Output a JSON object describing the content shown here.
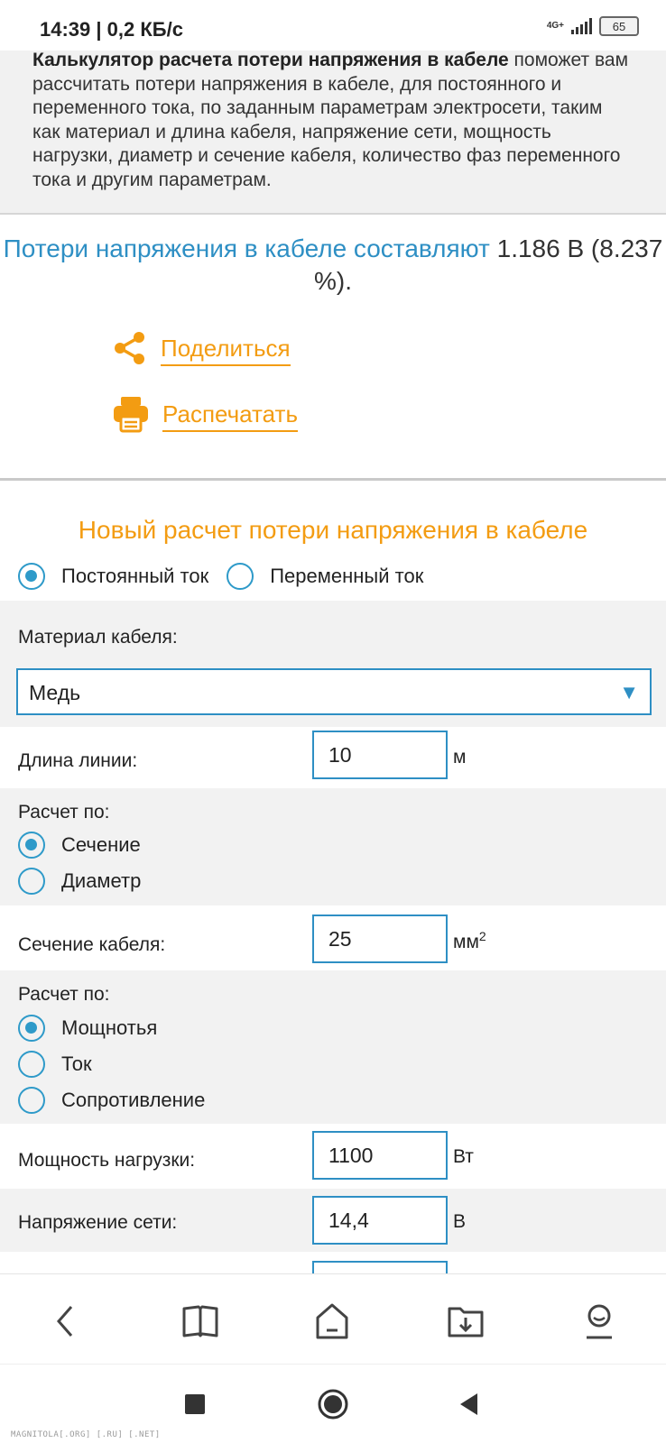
{
  "status": {
    "time": "14:39",
    "speed": "| 0,2 КБ/с",
    "network": "4G+",
    "battery": "65"
  },
  "intro": {
    "bold": "Калькулятор расчета потери напряжения в кабеле",
    "rest": " поможет вам рассчитать потери напряжения в кабеле, для постоянного и переменного тока, по заданным параметрам электросети, таким как материал и длина кабеля, напряжение сети, мощность нагрузки, диаметр и сечение кабеля, количество фаз переменного тока и другим параметрам."
  },
  "result": {
    "label": "Потери напряжения в кабеле составляют",
    "value": " 1.186 В (8.237 %)."
  },
  "actions": {
    "share": "Поделиться",
    "print": "Распечатать"
  },
  "form": {
    "title": "Новый расчет потери напряжения в кабеле",
    "current_types": [
      {
        "label": "Постоянный ток",
        "checked": true
      },
      {
        "label": "Переменный ток",
        "checked": false
      }
    ],
    "material_label": "Материал кабеля:",
    "material_value": "Медь",
    "length_label": "Длина линии:",
    "length_value": "10",
    "length_unit": "м",
    "calc_by_label_1": "Расчет по:",
    "calc_by_options_1": [
      {
        "label": "Сечение",
        "checked": true
      },
      {
        "label": "Диаметр",
        "checked": false
      }
    ],
    "section_label": "Сечение кабеля:",
    "section_value": "25",
    "section_unit": "мм",
    "section_unit_sup": "2",
    "calc_by_label_2": "Расчет по:",
    "calc_by_options_2": [
      {
        "label": "Мощнотья",
        "checked": true
      },
      {
        "label": "Ток",
        "checked": false
      },
      {
        "label": "Сопротивление",
        "checked": false
      }
    ],
    "power_label": "Мощность нагрузки:",
    "power_value": "1100",
    "power_unit": "Вт",
    "voltage_label": "Напряжение сети:",
    "voltage_value": "14,4",
    "voltage_unit": "В"
  },
  "watermark": "MAGNITOLA[.ORG] [.RU] [.NET]",
  "colors": {
    "accent_blue": "#2e8fc4",
    "accent_orange": "#f39c12"
  }
}
